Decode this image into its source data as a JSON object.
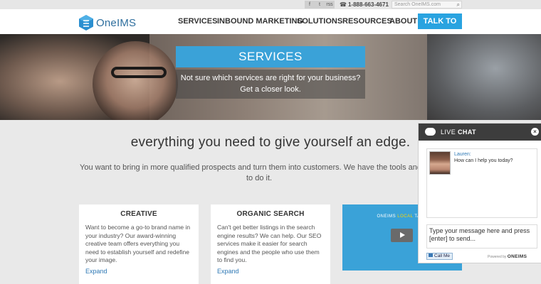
{
  "topbar": {
    "social": [
      "f",
      "t",
      "rss",
      "g+"
    ],
    "phone": "1-888-663-4671",
    "search_placeholder": "Search OneIMS.com"
  },
  "header": {
    "logo": "OneIMS",
    "nav": [
      "SERVICES",
      "INBOUND MARKETING",
      "SOLUTIONS",
      "RESOURCES",
      "ABOUT"
    ],
    "cta": "TALK TO US"
  },
  "hero": {
    "title": "SERVICES",
    "subtitle_line1": "Not sure which services are right for your business?",
    "subtitle_line2": "Get a closer look."
  },
  "main": {
    "headline": "everything you need to give yourself an edge.",
    "intro_line1": "You want to bring in more qualified prospects and turn them into customers. We have the tools and t",
    "intro_line2": "to do it."
  },
  "cards": [
    {
      "title": "CREATIVE",
      "body": "Want to become a go-to brand name in your industry? Our award-winning creative team offers everything you need to establish yourself and redefine your image.",
      "link": "Expand"
    },
    {
      "title": "ORGANIC SEARCH",
      "body": "Can't get better listings in the search engine results? We can help. Our SEO services make it easier for search engines and the people who use them to find you.",
      "link": "Expand"
    }
  ],
  "video": {
    "label_prefix": "ONEIMS",
    "label_local": "LOCAL",
    "label_suffix": "TARG"
  },
  "chat": {
    "title_light": "LIVE",
    "title_bold": "CHAT",
    "close": "×",
    "agent_name": "Lauren:",
    "agent_message": "How can I help you today?",
    "input_placeholder": "Type your message here and press [enter] to send...",
    "call_me": "Call Me",
    "powered_by": "Powered by",
    "powered_brand": "ONEIMS"
  },
  "colors": {
    "accent": "#29a3e0",
    "banner": "#3aa2d8",
    "chat_header": "#3d3d3d",
    "link": "#2f79b5"
  }
}
